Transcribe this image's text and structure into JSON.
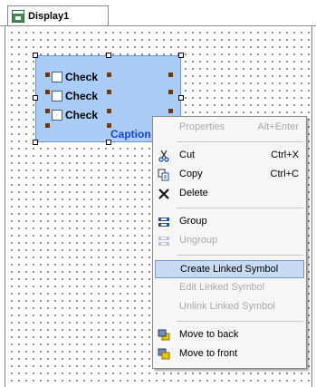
{
  "tab": {
    "title": "Display1",
    "icon": "display-window-icon"
  },
  "symbol": {
    "checkboxes": [
      "Check",
      "Check",
      "Check"
    ],
    "caption": "Caption"
  },
  "context_menu": {
    "items": [
      {
        "label": "Properties",
        "shortcut": "Alt+Enter",
        "enabled": false,
        "icon": ""
      },
      {
        "label": "Cut",
        "shortcut": "Ctrl+X",
        "enabled": true,
        "icon": "scissors-icon"
      },
      {
        "label": "Copy",
        "shortcut": "Ctrl+C",
        "enabled": true,
        "icon": "copy-icon"
      },
      {
        "label": "Delete",
        "shortcut": "",
        "enabled": true,
        "icon": "x-delete-icon"
      },
      {
        "label": "Group",
        "shortcut": "",
        "enabled": true,
        "icon": "group-icon"
      },
      {
        "label": "Ungroup",
        "shortcut": "",
        "enabled": false,
        "icon": "ungroup-icon"
      },
      {
        "label": "Create Linked Symbol",
        "shortcut": "",
        "enabled": true,
        "highlighted": true,
        "icon": ""
      },
      {
        "label": "Edit Linked Symbol",
        "shortcut": "",
        "enabled": false,
        "icon": ""
      },
      {
        "label": "Unlink Linked Symbol",
        "shortcut": "",
        "enabled": false,
        "icon": ""
      },
      {
        "label": "Move to back",
        "shortcut": "",
        "enabled": true,
        "icon": "move-to-back-icon"
      },
      {
        "label": "Move to front",
        "shortcut": "",
        "enabled": true,
        "icon": "move-to-front-icon"
      }
    ]
  }
}
